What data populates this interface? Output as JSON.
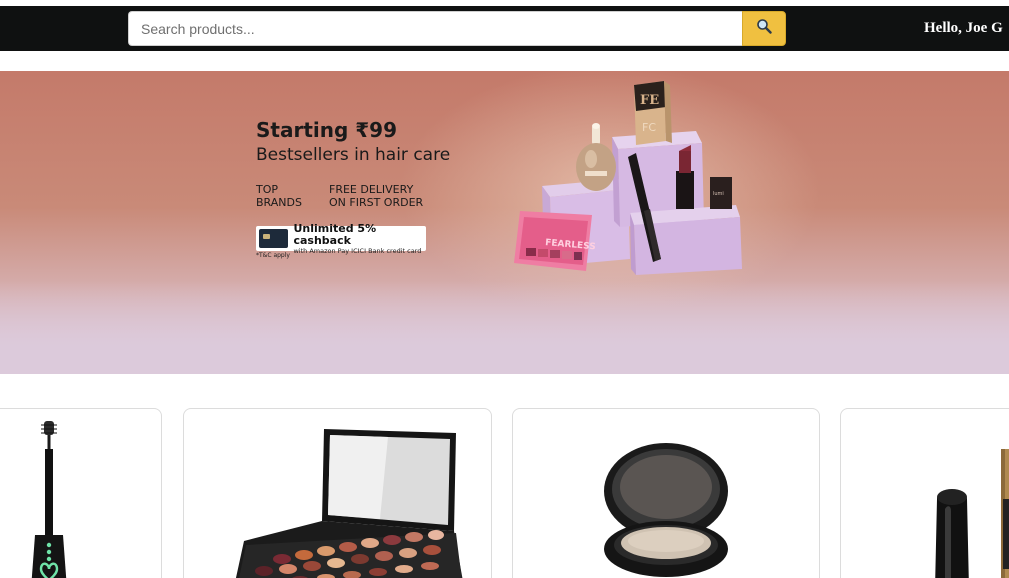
{
  "header": {
    "search": {
      "placeholder": "Search products...",
      "value": "",
      "button_icon": "search-icon"
    },
    "greeting": "Hello, Joe G"
  },
  "banner": {
    "title_line1": "Starting ₹99",
    "title_line2": "Bestsellers in hair care",
    "feature1_line1": "TOP",
    "feature1_line2": "BRANDS",
    "feature2_line1": "FREE DELIVERY",
    "feature2_line2": "ON FIRST ORDER",
    "cashback_main": "Unlimited 5% cashback",
    "cashback_sub": "with Amazon Pay ICICI Bank credit card",
    "tnc": "*T&C apply",
    "palette_label": "FEARLESS"
  },
  "products": [
    {
      "name": "mascara",
      "image": "mascara-image"
    },
    {
      "name": "eyeshadow-palette",
      "image": "eyeshadow-palette-image"
    },
    {
      "name": "compact-powder",
      "image": "compact-powder-image"
    },
    {
      "name": "lipstick",
      "image": "lipstick-image"
    }
  ],
  "colors": {
    "navbar": "#0f1111",
    "search_button": "#f0c040",
    "banner_top": "#c47a6a",
    "banner_bottom": "#ddcbdb"
  }
}
